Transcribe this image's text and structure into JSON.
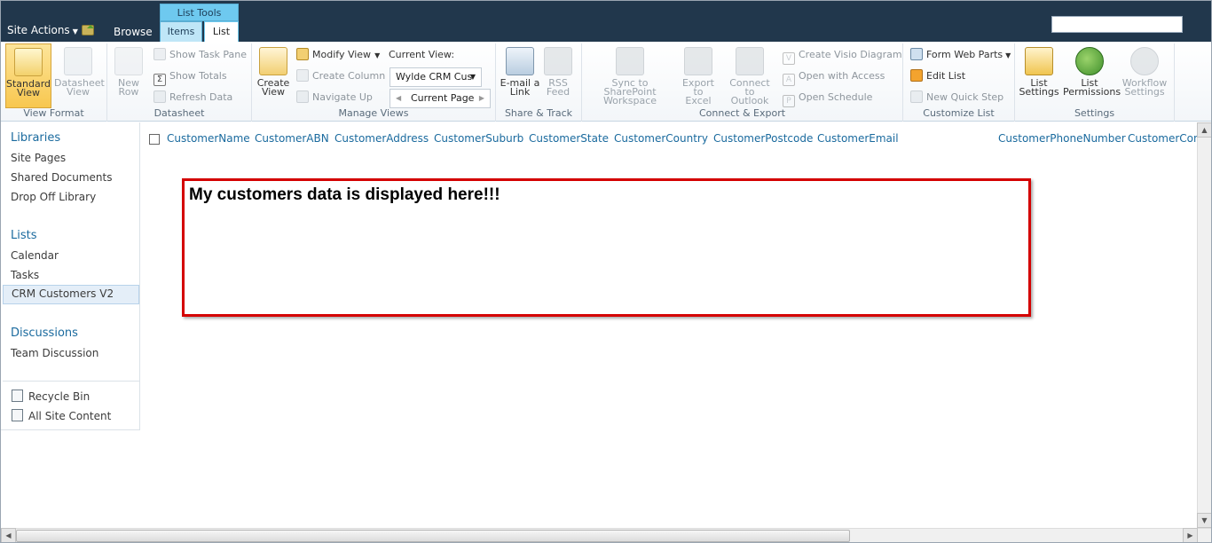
{
  "topbar": {
    "site_actions": "Site Actions",
    "browse": "Browse",
    "list_tools": "List Tools",
    "tab_items": "Items",
    "tab_list": "List"
  },
  "ribbon": {
    "view_format": {
      "label": "View Format",
      "standard_view": [
        "Standard",
        "View"
      ],
      "datasheet_view": [
        "Datasheet",
        "View"
      ]
    },
    "datasheet": {
      "label": "Datasheet",
      "new_row": [
        "New",
        "Row"
      ],
      "show_task_pane": "Show Task Pane",
      "show_totals": "Show Totals",
      "refresh_data": "Refresh Data"
    },
    "manage_views": {
      "label": "Manage Views",
      "create_view": [
        "Create",
        "View"
      ],
      "modify_view": "Modify View",
      "create_column": "Create Column",
      "navigate_up": "Navigate Up",
      "current_view_label": "Current View:",
      "current_view_value": "Wylde CRM Cus",
      "current_page": "Current Page"
    },
    "share_track": {
      "label": "Share & Track",
      "email_link": [
        "E-mail a",
        "Link"
      ],
      "rss_feed": [
        "RSS",
        "Feed"
      ]
    },
    "connect_export": {
      "label": "Connect & Export",
      "sync": [
        "Sync to SharePoint",
        "Workspace"
      ],
      "export_excel": [
        "Export to",
        "Excel"
      ],
      "connect_outlook": [
        "Connect to",
        "Outlook"
      ],
      "create_visio": "Create Visio Diagram",
      "open_access": "Open with Access",
      "open_schedule": "Open Schedule"
    },
    "customize_list": {
      "label": "Customize List",
      "form_web_parts": "Form Web Parts",
      "edit_list": "Edit List",
      "new_quick_step": "New Quick Step"
    },
    "settings": {
      "label": "Settings",
      "list_settings": [
        "List",
        "Settings"
      ],
      "list_permissions": [
        "List",
        "Permissions"
      ],
      "workflow_settings": [
        "Workflow",
        "Settings"
      ]
    }
  },
  "leftnav": {
    "libraries": "Libraries",
    "site_pages": "Site Pages",
    "shared_documents": "Shared Documents",
    "drop_off_library": "Drop Off Library",
    "lists": "Lists",
    "calendar": "Calendar",
    "tasks": "Tasks",
    "crm_customers": "CRM Customers V2",
    "discussions": "Discussions",
    "team_discussion": "Team Discussion",
    "recycle_bin": "Recycle Bin",
    "all_site_content": "All Site Content"
  },
  "columns": [
    "CustomerName",
    "CustomerABN",
    "CustomerAddress",
    "CustomerSuburb",
    "CustomerState",
    "CustomerCountry",
    "CustomerPostcode",
    "CustomerEmail",
    "CustomerPhoneNumber",
    "CustomerCon"
  ],
  "content": {
    "message": "My customers data is displayed here!!!"
  },
  "colors": {
    "topbar": "#21374c",
    "link": "#1a6a9e",
    "highlight_box": "#d40000"
  }
}
